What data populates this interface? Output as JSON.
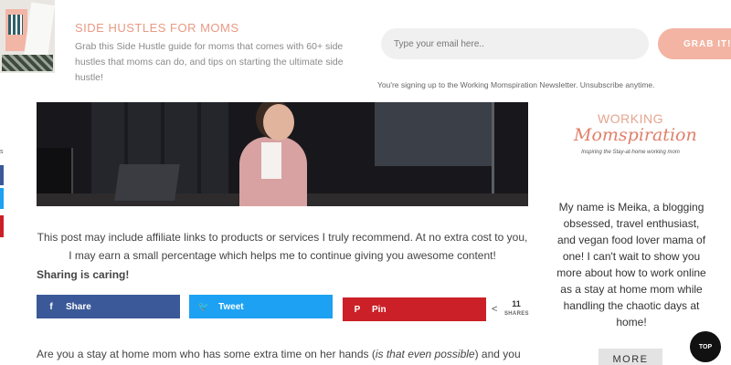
{
  "optin": {
    "title": "SIDE HUSTLES FOR MOMS",
    "text": "Grab this Side Hustle guide for moms that comes with 60+ side hustles that moms can do, and tips on starting the ultimate side hustle!",
    "email_placeholder": "Type your email here..",
    "button_label": "GRAB IT!",
    "note": "You're signing up to the Working Momspiration Newsletter. Unsubscribe anytime.",
    "colors": {
      "accent": "#f3b4a3",
      "title": "#e89a84"
    }
  },
  "article": {
    "disclaimer": "This post may include affiliate links to products or services I truly recommend. At no extra cost to you, I may earn a small percentage which helps me to continue giving you awesome content!",
    "sharing_heading": "Sharing is caring!",
    "share_buttons": [
      {
        "label": "Share",
        "icon": "facebook-icon",
        "glyph": "f",
        "color": "#3b5998"
      },
      {
        "label": "Tweet",
        "icon": "twitter-icon",
        "glyph": "🐦",
        "color": "#1da1f2"
      },
      {
        "label": "Pin",
        "icon": "pinterest-icon",
        "glyph": "P",
        "color": "#cb2027"
      }
    ],
    "share_count": "11",
    "share_count_label": "SHARES",
    "body_start": "Are you a stay at home mom who has some extra time on her hands (",
    "body_emphasis": "is that even possible",
    "body_end": ") and you"
  },
  "floating_share": {
    "label": "s"
  },
  "sidebar": {
    "logo": {
      "line1": "WORKING",
      "line2": "Momspiration",
      "tagline": "Inspiring the Stay-at-home working mom"
    },
    "bio": "My name is Meika, a blogging obsessed, travel enthusiast, and vegan food lover mama of one! I can't wait to show you more about how to work online as a stay at home mom while handling the chaotic days at home!",
    "more_label": "MORE"
  },
  "top_button_label": "TOP"
}
